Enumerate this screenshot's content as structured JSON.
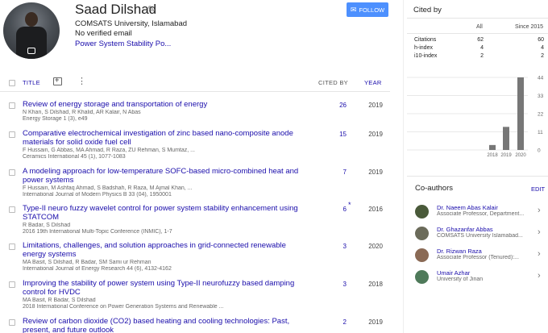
{
  "profile": {
    "name": "Saad Dilshad",
    "affiliation": "COMSATS University, Islamabad",
    "email": "No verified email",
    "interest": "Power System Stability Po...",
    "follow_label": "FOLLOW"
  },
  "table": {
    "col_title": "TITLE",
    "col_cited": "CITED BY",
    "col_year": "YEAR"
  },
  "articles": [
    {
      "title": "Review of energy storage and transportation of energy",
      "authors": "N Khan, S Dilshad, R Khalid, AR Kalair, N Abas",
      "venue": "Energy Storage 1 (3), e49",
      "cited": "26",
      "year": "2019"
    },
    {
      "title": "Comparative electrochemical investigation of zinc based nano-composite anode materials for solid oxide fuel cell",
      "authors": "F Hussain, G Abbas, MA Ahmad, R Raza, ZU Rehman, S Mumtaz, ...",
      "venue": "Ceramics International 45 (1), 1077-1083",
      "cited": "15",
      "year": "2019"
    },
    {
      "title": "A modeling approach for low-temperature SOFC-based micro-combined heat and power systems",
      "authors": "F Hussain, M Ashfaq Ahmad, S Badshah, R Raza, M Ajmal Khan, ...",
      "venue": "International Journal of Modern Physics B 33 (04), 1950001",
      "cited": "7",
      "year": "2019"
    },
    {
      "title": "Type-II neuro fuzzy wavelet control for power system stability enhancement using STATCOM",
      "authors": "R Badar, S Dilshad",
      "venue": "2016 19th International Multi-Topic Conference (INMIC), 1-7",
      "cited": "6",
      "year": "2016",
      "star": "*"
    },
    {
      "title": "Limitations, challenges, and solution approaches in grid-connected renewable energy systems",
      "authors": "MA Basit, S Dilshad, R Badar, SM Sami ur Rehman",
      "venue": "International Journal of Energy Research 44 (6), 4132-4162",
      "cited": "3",
      "year": "2020"
    },
    {
      "title": "Improving the stability of power system using Type-II neurofuzzy based damping control for HVDC",
      "authors": "MA Basit, R Badar, S Dilshad",
      "venue": "2018 International Conference on Power Generation Systems and Renewable ...",
      "cited": "3",
      "year": "2018"
    },
    {
      "title": "Review of carbon dioxide (CO2) based heating and cooling technologies: Past, present, and future outlook",
      "authors": "",
      "venue": "",
      "cited": "2",
      "year": "2019"
    }
  ],
  "cited_by": {
    "title": "Cited by",
    "col_all": "All",
    "col_since": "Since 2015",
    "metrics": [
      {
        "label": "Citations",
        "all": "62",
        "since": "60"
      },
      {
        "label": "h-index",
        "all": "4",
        "since": "4"
      },
      {
        "label": "i10-index",
        "all": "2",
        "since": "2"
      }
    ]
  },
  "chart_data": {
    "type": "bar",
    "categories": [
      "2018",
      "2019",
      "2020"
    ],
    "values": [
      3,
      14,
      44
    ],
    "y_ticks": [
      "44",
      "33",
      "22",
      "11",
      "0"
    ],
    "ylim": [
      0,
      44
    ],
    "bar_color": "#777777"
  },
  "coauthors": {
    "title": "Co-authors",
    "edit_label": "EDIT",
    "items": [
      {
        "name": "Dr. Naeem Abas Kalair",
        "affiliation": "Associate Professor, Department...",
        "avatar_color": "#4a5a3a"
      },
      {
        "name": "Dr. Ghazanfar Abbas",
        "affiliation": "COMSATS University Islamabad...",
        "avatar_color": "#6b6b5a"
      },
      {
        "name": "Dr. Rizwan Raza",
        "affiliation": "Associate Professor (Tenured):...",
        "avatar_color": "#8a6a55"
      },
      {
        "name": "Umair Azhar",
        "affiliation": "University of Jinan",
        "avatar_color": "#4f7a5a"
      }
    ]
  },
  "colors": {
    "link": "#1a0dab",
    "follow_bg": "#4d90fe"
  }
}
